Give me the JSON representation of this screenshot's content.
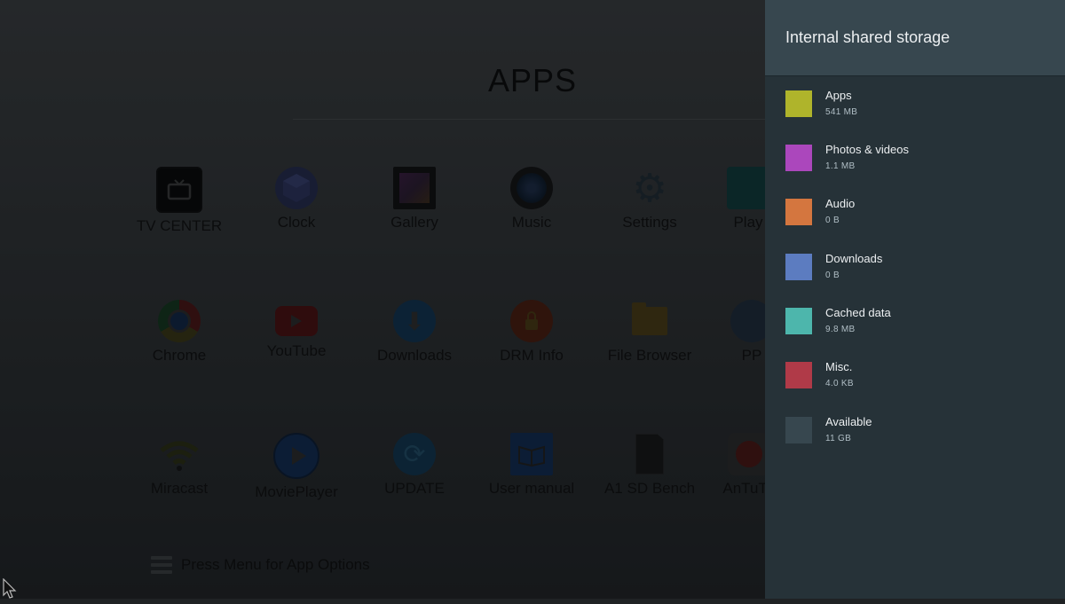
{
  "launcher": {
    "title": "APPS",
    "rows": [
      [
        {
          "label": "TV CENTER",
          "icon": "tv-icon",
          "color": "#050505"
        },
        {
          "label": "Clock",
          "icon": "clock-icon",
          "color": "#232a4e"
        },
        {
          "label": "Gallery",
          "icon": "gallery-icon",
          "color": "#2b1b2c"
        },
        {
          "label": "Music",
          "icon": "music-icon",
          "color": "#0c1a2c"
        },
        {
          "label": "Settings",
          "icon": "gear-icon",
          "color": "#1e2a33"
        },
        {
          "label": "Play",
          "icon": "play-store-icon",
          "color": "#0d3a3a"
        }
      ],
      [
        {
          "label": "Chrome",
          "icon": "chrome-icon",
          "color": "#3b2a12"
        },
        {
          "label": "YouTube",
          "icon": "youtube-icon",
          "color": "#4a0d0d"
        },
        {
          "label": "Downloads",
          "icon": "download-icon",
          "color": "#0f3352"
        },
        {
          "label": "DRM Info",
          "icon": "lock-icon",
          "color": "#4a1a0c"
        },
        {
          "label": "File Browser",
          "icon": "folder-icon",
          "color": "#4b3c12"
        },
        {
          "label": "PP",
          "icon": "pp-icon",
          "color": "#1d2a3a"
        }
      ],
      [
        {
          "label": "Miracast",
          "icon": "wifi-icon",
          "color": "#2a2d10"
        },
        {
          "label": "MoviePlayer",
          "icon": "movie-player-icon",
          "color": "#0e2a52"
        },
        {
          "label": "UPDATE",
          "icon": "update-icon",
          "color": "#0e3550"
        },
        {
          "label": "User manual",
          "icon": "book-icon",
          "color": "#0e2a52"
        },
        {
          "label": "A1 SD Bench",
          "icon": "sd-card-icon",
          "color": "#141414"
        },
        {
          "label": "AnTuTu",
          "icon": "antutu-icon",
          "color": "#4a1410"
        }
      ]
    ],
    "hint": "Press Menu for App Options"
  },
  "storage": {
    "title": "Internal shared storage",
    "items": [
      {
        "name": "Apps",
        "size": "541 MB",
        "color": "#afb42b"
      },
      {
        "name": "Photos & videos",
        "size": "1.1 MB",
        "color": "#ab47bc"
      },
      {
        "name": "Audio",
        "size": "0 B",
        "color": "#d4763f"
      },
      {
        "name": "Downloads",
        "size": "0 B",
        "color": "#5c7cc0"
      },
      {
        "name": "Cached data",
        "size": "9.8 MB",
        "color": "#4db6ac"
      },
      {
        "name": "Misc.",
        "size": "4.0 KB",
        "color": "#b03a48"
      },
      {
        "name": "Available",
        "size": "11 GB",
        "color": "#37474f"
      }
    ]
  }
}
